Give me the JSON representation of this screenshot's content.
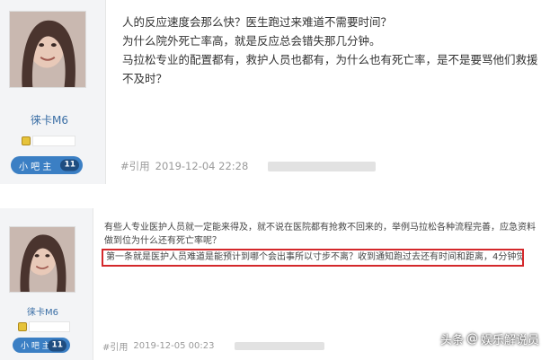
{
  "posts": [
    {
      "username": "徕卡M6",
      "rank_label": "小 吧 主",
      "rank_level": "11",
      "paragraphs": [
        "人的反应速度会那么快？医生跑过来难道不需要时间？",
        "为什么院外死亡率高，就是反应总会错失那几分钟。",
        "马拉松专业的配置都有，救护人员也都有，为什么也有死亡率，是不是要骂他们救援不及时？"
      ],
      "reply_label": "#引用",
      "timestamp": "2019-12-04 22:28"
    },
    {
      "username": "徕卡M6",
      "rank_label": "小 吧 主",
      "rank_level": "11",
      "paragraph": "有些人专业医护人员就一定能来得及，就不说在医院都有抢救不回来的，举例马拉松各种流程完善，应急资料做到位为什么还有死亡率呢？",
      "highlight": "第一条就是医护人员难道是能预计到哪个会出事所以寸步不离？收到通知跑过去还有时间和距离，4分钟觉得很长吗？",
      "reply_label": "#引用",
      "timestamp": "2019-12-05 00:23"
    }
  ],
  "watermark": {
    "source": "头条",
    "separator": "@",
    "account": "娱乐解说员"
  },
  "colors": {
    "accent": "#3b7fc4",
    "username": "#3a6ea5",
    "highlight_border": "#d4282b"
  },
  "icons": {
    "medal": "medal-icon",
    "avatar": "avatar"
  }
}
